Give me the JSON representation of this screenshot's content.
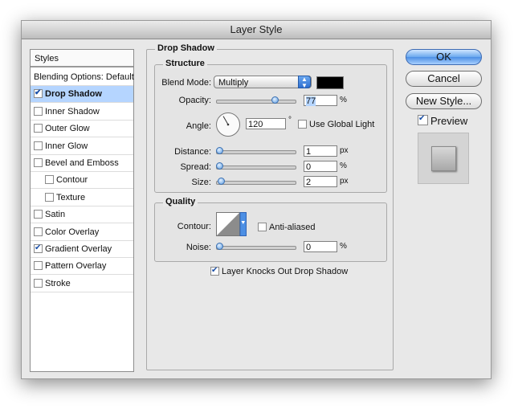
{
  "window": {
    "title": "Layer Style"
  },
  "styles_panel": {
    "header": "Styles",
    "items": [
      {
        "label": "Blending Options: Default",
        "checkbox": false,
        "checked": false,
        "indent": 0,
        "bold": false,
        "selected": false
      },
      {
        "label": "Drop Shadow",
        "checkbox": true,
        "checked": true,
        "indent": 0,
        "bold": true,
        "selected": true
      },
      {
        "label": "Inner Shadow",
        "checkbox": true,
        "checked": false,
        "indent": 0,
        "bold": false,
        "selected": false
      },
      {
        "label": "Outer Glow",
        "checkbox": true,
        "checked": false,
        "indent": 0,
        "bold": false,
        "selected": false
      },
      {
        "label": "Inner Glow",
        "checkbox": true,
        "checked": false,
        "indent": 0,
        "bold": false,
        "selected": false
      },
      {
        "label": "Bevel and Emboss",
        "checkbox": true,
        "checked": false,
        "indent": 0,
        "bold": false,
        "selected": false
      },
      {
        "label": "Contour",
        "checkbox": true,
        "checked": false,
        "indent": 1,
        "bold": false,
        "selected": false
      },
      {
        "label": "Texture",
        "checkbox": true,
        "checked": false,
        "indent": 1,
        "bold": false,
        "selected": false
      },
      {
        "label": "Satin",
        "checkbox": true,
        "checked": false,
        "indent": 0,
        "bold": false,
        "selected": false
      },
      {
        "label": "Color Overlay",
        "checkbox": true,
        "checked": false,
        "indent": 0,
        "bold": false,
        "selected": false
      },
      {
        "label": "Gradient Overlay",
        "checkbox": true,
        "checked": true,
        "indent": 0,
        "bold": false,
        "selected": false
      },
      {
        "label": "Pattern Overlay",
        "checkbox": true,
        "checked": false,
        "indent": 0,
        "bold": false,
        "selected": false
      },
      {
        "label": "Stroke",
        "checkbox": true,
        "checked": false,
        "indent": 0,
        "bold": false,
        "selected": false
      }
    ]
  },
  "drop_shadow": {
    "title": "Drop Shadow",
    "structure": {
      "title": "Structure",
      "blend_mode": {
        "label": "Blend Mode:",
        "value": "Multiply",
        "color": "#000000"
      },
      "opacity": {
        "label": "Opacity:",
        "value": "77",
        "unit": "%",
        "level": 0.77
      },
      "angle": {
        "label": "Angle:",
        "value": "120",
        "unit": "°",
        "degrees": 120
      },
      "use_global_light": {
        "label": "Use Global Light",
        "checked": false
      },
      "distance": {
        "label": "Distance:",
        "value": "1",
        "unit": "px",
        "level": 0.0
      },
      "spread": {
        "label": "Spread:",
        "value": "0",
        "unit": "%",
        "level": 0.0
      },
      "size": {
        "label": "Size:",
        "value": "2",
        "unit": "px",
        "level": 0.02
      }
    },
    "quality": {
      "title": "Quality",
      "contour": {
        "label": "Contour:"
      },
      "anti_aliased": {
        "label": "Anti-aliased",
        "checked": false
      },
      "noise": {
        "label": "Noise:",
        "value": "0",
        "unit": "%",
        "level": 0.0
      }
    },
    "knocks_out": {
      "label": "Layer Knocks Out Drop Shadow",
      "checked": true
    }
  },
  "buttons": {
    "ok": "OK",
    "cancel": "Cancel",
    "new_style": "New Style...",
    "preview": {
      "label": "Preview",
      "checked": true
    }
  },
  "colors": {
    "accent": "#4c8fe4",
    "selection": "#b5d5ff"
  }
}
